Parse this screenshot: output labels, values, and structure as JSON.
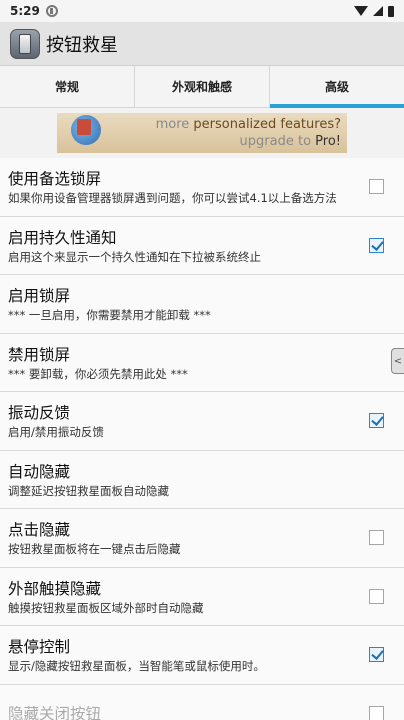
{
  "status_bar": {
    "time": "5:29"
  },
  "app": {
    "title": "按钮救星"
  },
  "tabs": [
    {
      "label": "常规",
      "active": false
    },
    {
      "label": "外观和触感",
      "active": false
    },
    {
      "label": "高级",
      "active": true
    }
  ],
  "banner": {
    "line1_prefix": "more ",
    "line1_strong": "personalized features?",
    "line2_prefix": "upgrade to ",
    "line2_strong": "Pro!"
  },
  "settings": [
    {
      "title": "使用备选锁屏",
      "summary": "如果你用设备管理器锁屏遇到问题，你可以尝试4.1以上备选方法",
      "has_checkbox": true,
      "checked": false,
      "enabled": true
    },
    {
      "title": "启用持久性通知",
      "summary": "启用这个来显示一个持久性通知在下拉被系统终止",
      "has_checkbox": true,
      "checked": true,
      "enabled": true
    },
    {
      "title": "启用锁屏",
      "summary": "*** 一旦启用，你需要禁用才能卸载 ***",
      "has_checkbox": false,
      "checked": false,
      "enabled": true
    },
    {
      "title": "禁用锁屏",
      "summary": "*** 要卸载，你必须先禁用此处 ***",
      "has_checkbox": false,
      "checked": false,
      "enabled": true
    },
    {
      "title": "振动反馈",
      "summary": "启用/禁用振动反馈",
      "has_checkbox": true,
      "checked": true,
      "enabled": true
    },
    {
      "title": "自动隐藏",
      "summary": "调整延迟按钮救星面板自动隐藏",
      "has_checkbox": false,
      "checked": false,
      "enabled": true
    },
    {
      "title": "点击隐藏",
      "summary": "按钮救星面板将在一键点击后隐藏",
      "has_checkbox": true,
      "checked": false,
      "enabled": true
    },
    {
      "title": "外部触摸隐藏",
      "summary": "触摸按钮救星面板区域外部时自动隐藏",
      "has_checkbox": true,
      "checked": false,
      "enabled": true
    },
    {
      "title": "悬停控制",
      "summary": "显示/隐藏按钮救星面板，当智能笔或鼠标使用时。",
      "has_checkbox": true,
      "checked": true,
      "enabled": true
    },
    {
      "title": "隐藏关闭按钮",
      "summary": "",
      "has_checkbox": true,
      "checked": false,
      "enabled": false
    }
  ],
  "float_handle": {
    "glyph": "<"
  }
}
